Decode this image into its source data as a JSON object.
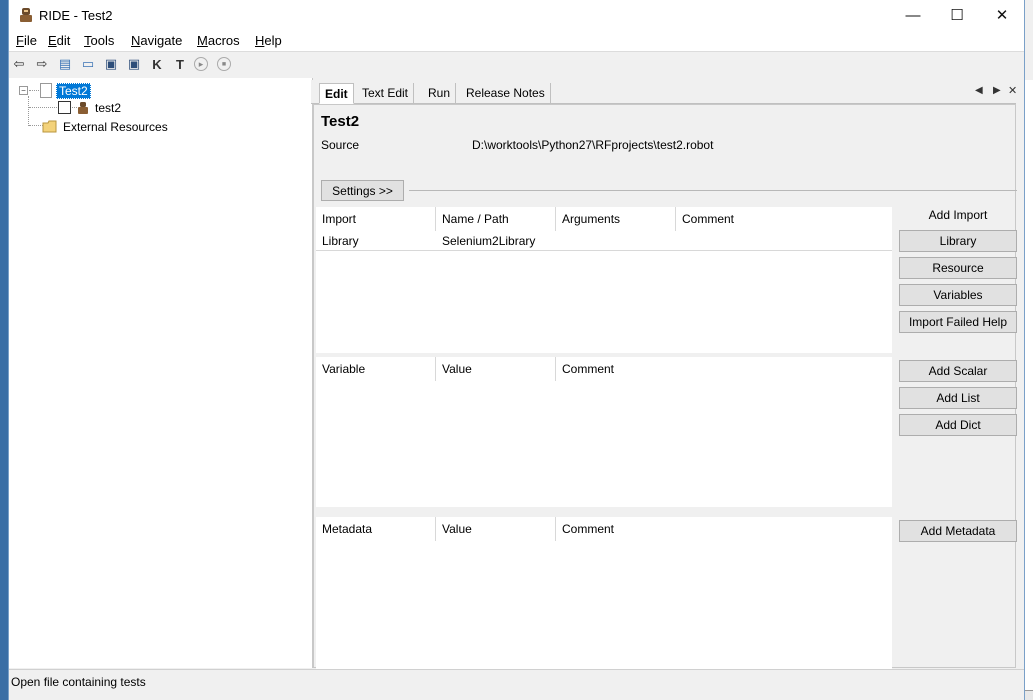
{
  "window": {
    "title": "RIDE - Test2",
    "minimize_glyph": "—",
    "maximize_glyph": "☐",
    "close_glyph": "✕"
  },
  "menu": {
    "items": [
      {
        "label": "File"
      },
      {
        "label": "Edit"
      },
      {
        "label": "Tools"
      },
      {
        "label": "Navigate"
      },
      {
        "label": "Macros"
      },
      {
        "label": "Help"
      }
    ]
  },
  "toolbar": {
    "buttons": [
      {
        "icon": "back-arrow-icon",
        "glyph": "⇦"
      },
      {
        "icon": "forward-arrow-icon",
        "glyph": "⇨"
      },
      {
        "icon": "open-suite-icon",
        "glyph": "▤"
      },
      {
        "icon": "open-directory-icon",
        "glyph": "▭"
      },
      {
        "icon": "save-icon",
        "glyph": "▣"
      },
      {
        "icon": "save-all-icon",
        "glyph": "▣"
      },
      {
        "icon": "search-keywords-icon",
        "glyph": "K"
      },
      {
        "icon": "search-tests-icon",
        "glyph": "T"
      },
      {
        "icon": "run-icon",
        "glyph": "▸"
      },
      {
        "icon": "stop-icon",
        "glyph": "■"
      }
    ]
  },
  "tree": {
    "root": {
      "label": "Test2",
      "expander": "−",
      "selected": true
    },
    "children": [
      {
        "label": "test2",
        "checked": false
      }
    ],
    "external": {
      "label": "External Resources"
    }
  },
  "tabs": [
    {
      "label": "Edit",
      "active": true
    },
    {
      "label": "Text Edit",
      "active": false
    },
    {
      "label": "Run",
      "active": false
    },
    {
      "label": "Release Notes",
      "active": false
    }
  ],
  "tab_nav": {
    "prev": "◀",
    "next": "▶",
    "close": "✕"
  },
  "editor": {
    "suite_name": "Test2",
    "source_label": "Source",
    "source_path": "D:\\worktools\\Python27\\RFprojects\\test2.robot",
    "settings_button": "Settings >>",
    "imports": {
      "columns": [
        "Import",
        "Name / Path",
        "Arguments",
        "Comment"
      ],
      "rows": [
        [
          "Library",
          "Selenium2Library",
          "",
          ""
        ]
      ],
      "side_heading": "Add Import",
      "buttons": [
        "Library",
        "Resource",
        "Variables",
        "Import Failed Help"
      ]
    },
    "variables": {
      "columns": [
        "Variable",
        "Value",
        "Comment"
      ],
      "buttons": [
        "Add Scalar",
        "Add List",
        "Add Dict"
      ]
    },
    "metadata": {
      "columns": [
        "Metadata",
        "Value",
        "Comment"
      ],
      "buttons": [
        "Add Metadata"
      ]
    }
  },
  "status": {
    "text": "Open file containing tests"
  }
}
